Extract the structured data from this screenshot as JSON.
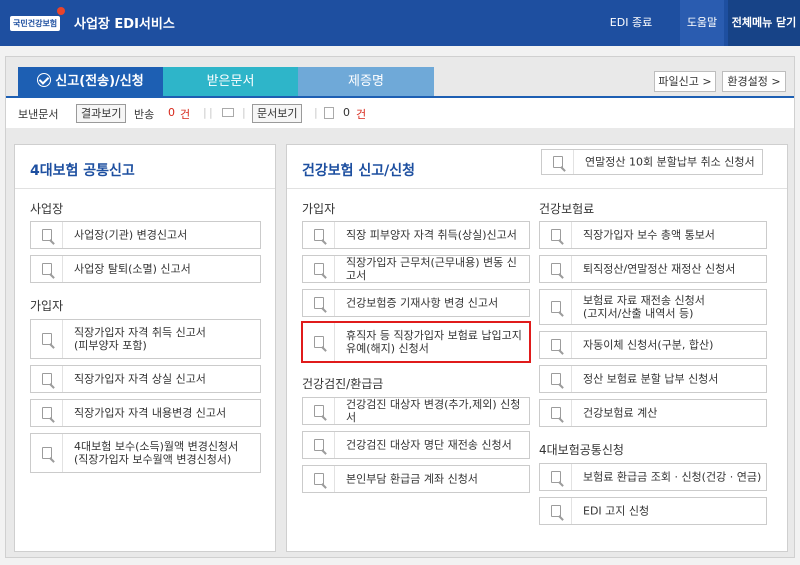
{
  "header": {
    "logo_text": "국민건강보험",
    "title": "사업장 EDI서비스",
    "edi_exit": "EDI 종료",
    "help": "도움말",
    "close_all_menu": "전체메뉴 닫기"
  },
  "tabs": [
    {
      "label": "신고(전송)/신청"
    },
    {
      "label": "받은문서"
    },
    {
      "label": "제증명"
    }
  ],
  "right_buttons": {
    "file_report": "파일신고 >",
    "env_settings": "환경설정 >"
  },
  "status": {
    "sent_label": "보낸문서",
    "result_btn": "결과보기",
    "returned_label": "반송",
    "returned_count": "0",
    "returned_unit": "건",
    "doc_view_btn": "문서보기",
    "doc_count": "0",
    "doc_unit": "건"
  },
  "left_column": {
    "title": "4대보험 공통신고",
    "sections": [
      {
        "title": "사업장",
        "items": [
          "사업장(기관) 변경신고서",
          "사업장 탈퇴(소멸) 신고서"
        ]
      },
      {
        "title": "가입자",
        "items": [
          "직장가입자 자격 취득 신고서\n(피부양자 포함)",
          "직장가입자 자격 상실 신고서",
          "직장가입자 자격 내용변경 신고서",
          "4대보험 보수(소득)월액 변경신청서\n(직장가입자 보수월액 변경신청서)"
        ]
      }
    ]
  },
  "right_column": {
    "title": "건강보험 신고/신청",
    "top_item": "연말정산 10회 분할납부 취소 신청서",
    "sections": [
      {
        "title": "가입자",
        "items": [
          "직장 피부양자 자격 취득(상실)신고서",
          "직장가입자 근무처(근무내용) 변동 신고서",
          "건강보험증 기재사항 변경 신고서",
          "휴직자 등 직장가입자 보험료 납입고지\n유예(해지) 신청서"
        ]
      },
      {
        "title": "건강검진/환급금",
        "items": [
          "건강검진 대상자 변경(추가,제외) 신청서",
          "건강검진 대상자 명단 재전송 신청서",
          "본인부담 환급금 계좌 신청서"
        ]
      },
      {
        "title": "건강보험료",
        "items": [
          "직장가입자 보수 총액 통보서",
          "퇴직정산/연말정산 재정산 신청서",
          "보험료 자료 재전송 신청서\n(고지서/산출 내역서 등)",
          "자동이체 신청서(구분, 합산)",
          "정산 보험료 분할 납부 신청서",
          "건강보험료 계산"
        ]
      },
      {
        "title": "4대보험공통신청",
        "items": [
          "보험료 환급금 조회 · 신청(건강 · 연금)",
          "EDI 고지 신청"
        ]
      }
    ]
  },
  "highlight": {
    "color": "#e01b1b"
  }
}
